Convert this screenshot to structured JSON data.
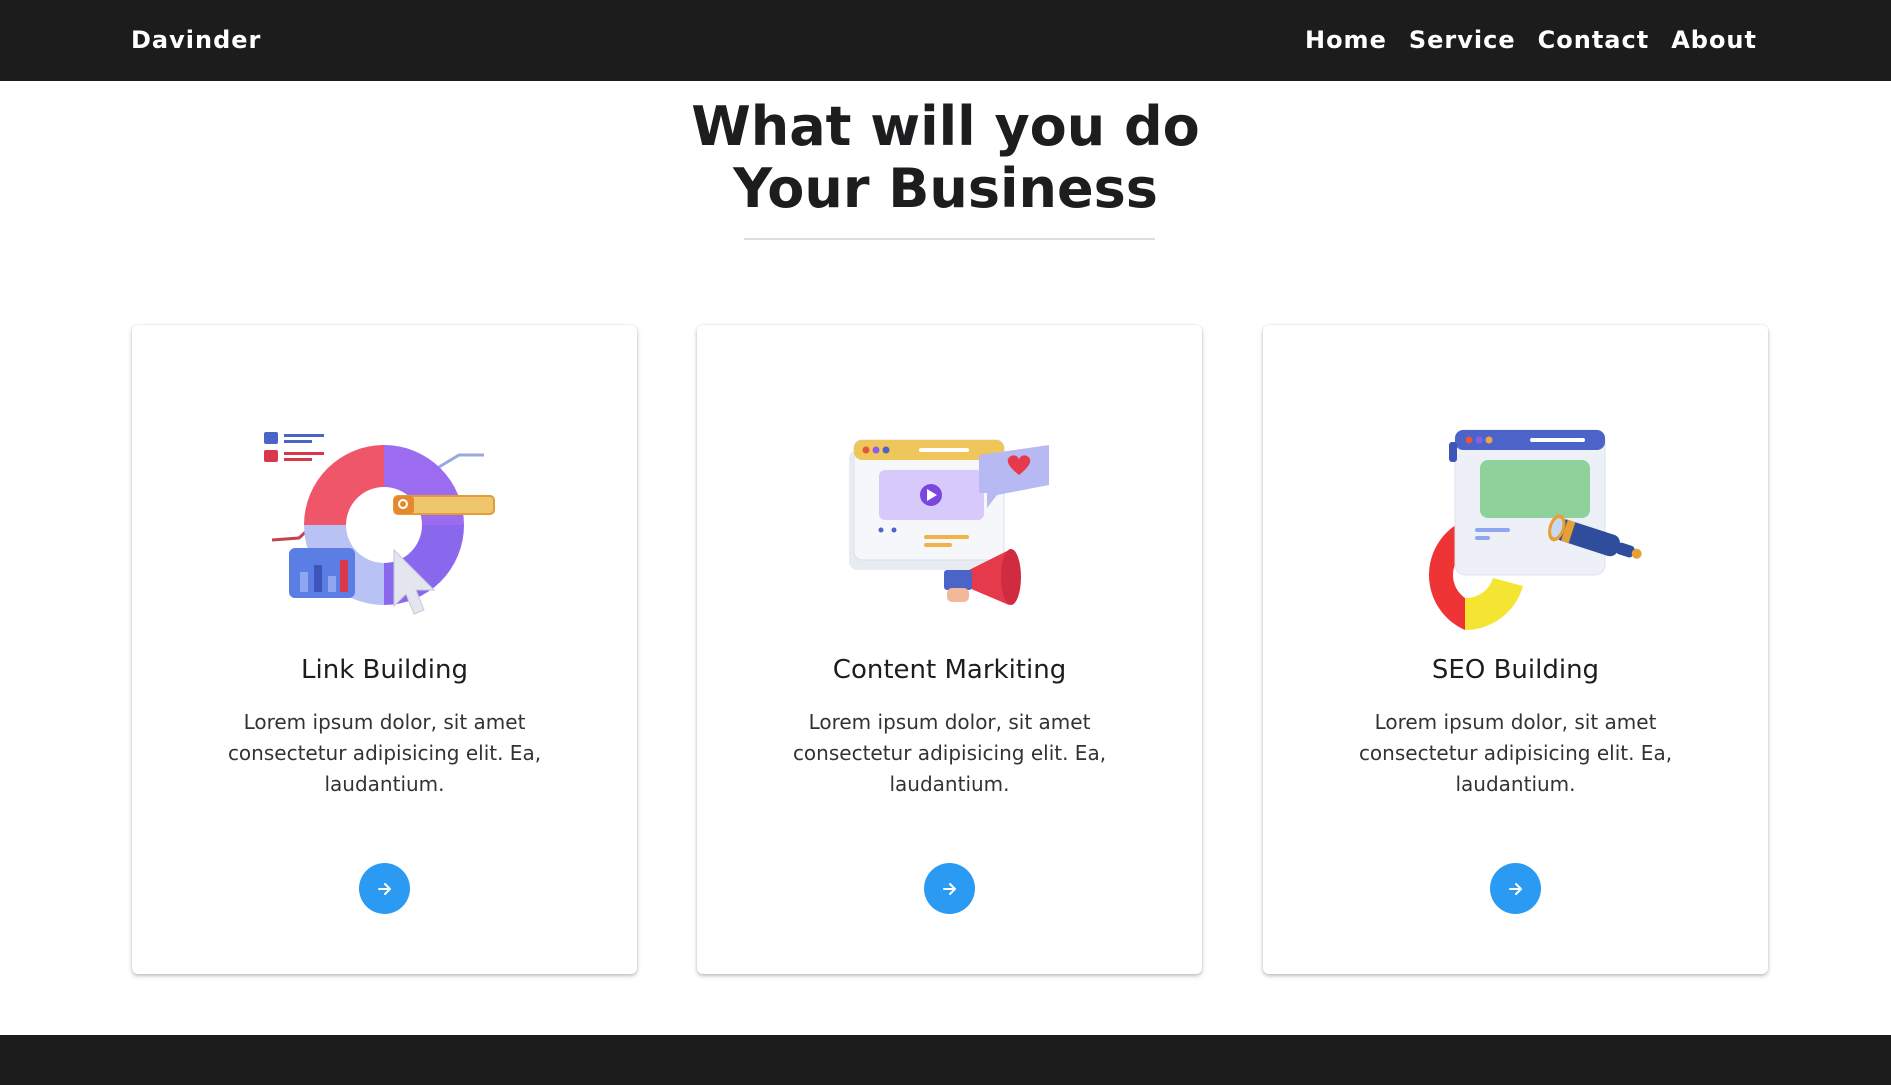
{
  "nav": {
    "brand": "Davinder",
    "links": [
      "Home",
      "Service",
      "Contact",
      "About"
    ]
  },
  "hero": {
    "heading_line1": "What will you do",
    "heading_line2": "Your Business"
  },
  "cards": [
    {
      "title": "Link Building",
      "text": "Lorem ipsum dolor, sit amet consectetur adipisicing elit. Ea, laudantium.",
      "illustration": "analytics-donut-search-icon"
    },
    {
      "title": "Content Markiting",
      "text": "Lorem ipsum dolor, sit amet consectetur adipisicing elit. Ea, laudantium.",
      "illustration": "video-megaphone-icon"
    },
    {
      "title": "SEO Building",
      "text": "Lorem ipsum dolor, sit amet consectetur adipisicing elit. Ea, laudantium.",
      "illustration": "browser-telescope-icon"
    }
  ],
  "colors": {
    "navbar_bg": "#1c1c1c",
    "accent_button": "#2b9af3",
    "text": "#1d1d1f"
  },
  "icons": {
    "card_button": "arrow-right-icon"
  }
}
